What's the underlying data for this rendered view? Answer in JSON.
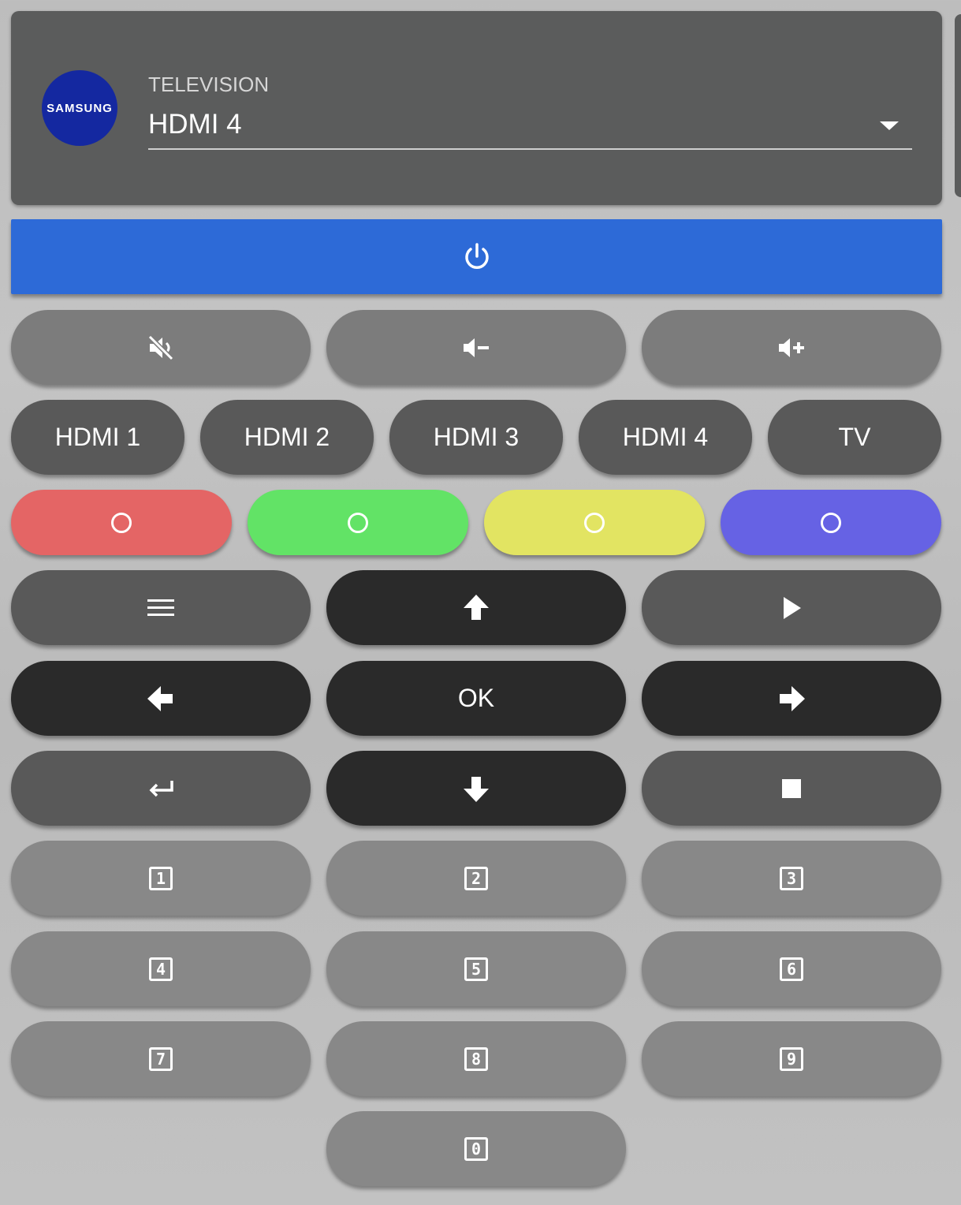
{
  "header": {
    "logo_text": "SAMSUNG",
    "select_label": "TELEVISION",
    "select_value": "HDMI 4"
  },
  "power": {
    "icon": "power-icon"
  },
  "volume": {
    "icons": [
      "volume-off-icon",
      "volume-minus-icon",
      "volume-plus-icon"
    ]
  },
  "sources": [
    "HDMI 1",
    "HDMI 2",
    "HDMI 3",
    "HDMI 4",
    "TV"
  ],
  "color_buttons": [
    {
      "name": "red",
      "color": "#e46565",
      "icon": "circle-outline-icon"
    },
    {
      "name": "green",
      "color": "#62e366",
      "icon": "circle-outline-icon"
    },
    {
      "name": "yellow",
      "color": "#e2e462",
      "icon": "circle-outline-icon"
    },
    {
      "name": "blue",
      "color": "#6662e4",
      "icon": "circle-outline-icon"
    }
  ],
  "nav": {
    "ok_label": "OK",
    "icons": [
      "menu-icon",
      "arrow-up-icon",
      "play-icon",
      "arrow-left-icon",
      "arrow-right-icon",
      "return-icon",
      "arrow-down-icon",
      "stop-icon"
    ]
  },
  "numpad": [
    "1",
    "2",
    "3",
    "4",
    "5",
    "6",
    "7",
    "8",
    "9",
    "0"
  ]
}
